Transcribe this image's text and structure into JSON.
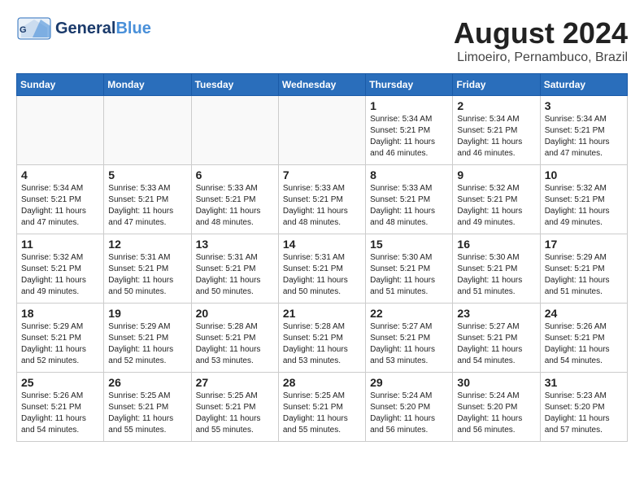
{
  "header": {
    "logo_line1": "General",
    "logo_line2": "Blue",
    "month_year": "August 2024",
    "location": "Limoeiro, Pernambuco, Brazil"
  },
  "days_of_week": [
    "Sunday",
    "Monday",
    "Tuesday",
    "Wednesday",
    "Thursday",
    "Friday",
    "Saturday"
  ],
  "weeks": [
    [
      {
        "day": "",
        "info": "",
        "empty": true
      },
      {
        "day": "",
        "info": "",
        "empty": true
      },
      {
        "day": "",
        "info": "",
        "empty": true
      },
      {
        "day": "",
        "info": "",
        "empty": true
      },
      {
        "day": "1",
        "info": "Sunrise: 5:34 AM\nSunset: 5:21 PM\nDaylight: 11 hours\nand 46 minutes."
      },
      {
        "day": "2",
        "info": "Sunrise: 5:34 AM\nSunset: 5:21 PM\nDaylight: 11 hours\nand 46 minutes."
      },
      {
        "day": "3",
        "info": "Sunrise: 5:34 AM\nSunset: 5:21 PM\nDaylight: 11 hours\nand 47 minutes."
      }
    ],
    [
      {
        "day": "4",
        "info": "Sunrise: 5:34 AM\nSunset: 5:21 PM\nDaylight: 11 hours\nand 47 minutes."
      },
      {
        "day": "5",
        "info": "Sunrise: 5:33 AM\nSunset: 5:21 PM\nDaylight: 11 hours\nand 47 minutes."
      },
      {
        "day": "6",
        "info": "Sunrise: 5:33 AM\nSunset: 5:21 PM\nDaylight: 11 hours\nand 48 minutes."
      },
      {
        "day": "7",
        "info": "Sunrise: 5:33 AM\nSunset: 5:21 PM\nDaylight: 11 hours\nand 48 minutes."
      },
      {
        "day": "8",
        "info": "Sunrise: 5:33 AM\nSunset: 5:21 PM\nDaylight: 11 hours\nand 48 minutes."
      },
      {
        "day": "9",
        "info": "Sunrise: 5:32 AM\nSunset: 5:21 PM\nDaylight: 11 hours\nand 49 minutes."
      },
      {
        "day": "10",
        "info": "Sunrise: 5:32 AM\nSunset: 5:21 PM\nDaylight: 11 hours\nand 49 minutes."
      }
    ],
    [
      {
        "day": "11",
        "info": "Sunrise: 5:32 AM\nSunset: 5:21 PM\nDaylight: 11 hours\nand 49 minutes."
      },
      {
        "day": "12",
        "info": "Sunrise: 5:31 AM\nSunset: 5:21 PM\nDaylight: 11 hours\nand 50 minutes."
      },
      {
        "day": "13",
        "info": "Sunrise: 5:31 AM\nSunset: 5:21 PM\nDaylight: 11 hours\nand 50 minutes."
      },
      {
        "day": "14",
        "info": "Sunrise: 5:31 AM\nSunset: 5:21 PM\nDaylight: 11 hours\nand 50 minutes."
      },
      {
        "day": "15",
        "info": "Sunrise: 5:30 AM\nSunset: 5:21 PM\nDaylight: 11 hours\nand 51 minutes."
      },
      {
        "day": "16",
        "info": "Sunrise: 5:30 AM\nSunset: 5:21 PM\nDaylight: 11 hours\nand 51 minutes."
      },
      {
        "day": "17",
        "info": "Sunrise: 5:29 AM\nSunset: 5:21 PM\nDaylight: 11 hours\nand 51 minutes."
      }
    ],
    [
      {
        "day": "18",
        "info": "Sunrise: 5:29 AM\nSunset: 5:21 PM\nDaylight: 11 hours\nand 52 minutes."
      },
      {
        "day": "19",
        "info": "Sunrise: 5:29 AM\nSunset: 5:21 PM\nDaylight: 11 hours\nand 52 minutes."
      },
      {
        "day": "20",
        "info": "Sunrise: 5:28 AM\nSunset: 5:21 PM\nDaylight: 11 hours\nand 53 minutes."
      },
      {
        "day": "21",
        "info": "Sunrise: 5:28 AM\nSunset: 5:21 PM\nDaylight: 11 hours\nand 53 minutes."
      },
      {
        "day": "22",
        "info": "Sunrise: 5:27 AM\nSunset: 5:21 PM\nDaylight: 11 hours\nand 53 minutes."
      },
      {
        "day": "23",
        "info": "Sunrise: 5:27 AM\nSunset: 5:21 PM\nDaylight: 11 hours\nand 54 minutes."
      },
      {
        "day": "24",
        "info": "Sunrise: 5:26 AM\nSunset: 5:21 PM\nDaylight: 11 hours\nand 54 minutes."
      }
    ],
    [
      {
        "day": "25",
        "info": "Sunrise: 5:26 AM\nSunset: 5:21 PM\nDaylight: 11 hours\nand 54 minutes."
      },
      {
        "day": "26",
        "info": "Sunrise: 5:25 AM\nSunset: 5:21 PM\nDaylight: 11 hours\nand 55 minutes."
      },
      {
        "day": "27",
        "info": "Sunrise: 5:25 AM\nSunset: 5:21 PM\nDaylight: 11 hours\nand 55 minutes."
      },
      {
        "day": "28",
        "info": "Sunrise: 5:25 AM\nSunset: 5:21 PM\nDaylight: 11 hours\nand 55 minutes."
      },
      {
        "day": "29",
        "info": "Sunrise: 5:24 AM\nSunset: 5:20 PM\nDaylight: 11 hours\nand 56 minutes."
      },
      {
        "day": "30",
        "info": "Sunrise: 5:24 AM\nSunset: 5:20 PM\nDaylight: 11 hours\nand 56 minutes."
      },
      {
        "day": "31",
        "info": "Sunrise: 5:23 AM\nSunset: 5:20 PM\nDaylight: 11 hours\nand 57 minutes."
      }
    ]
  ]
}
